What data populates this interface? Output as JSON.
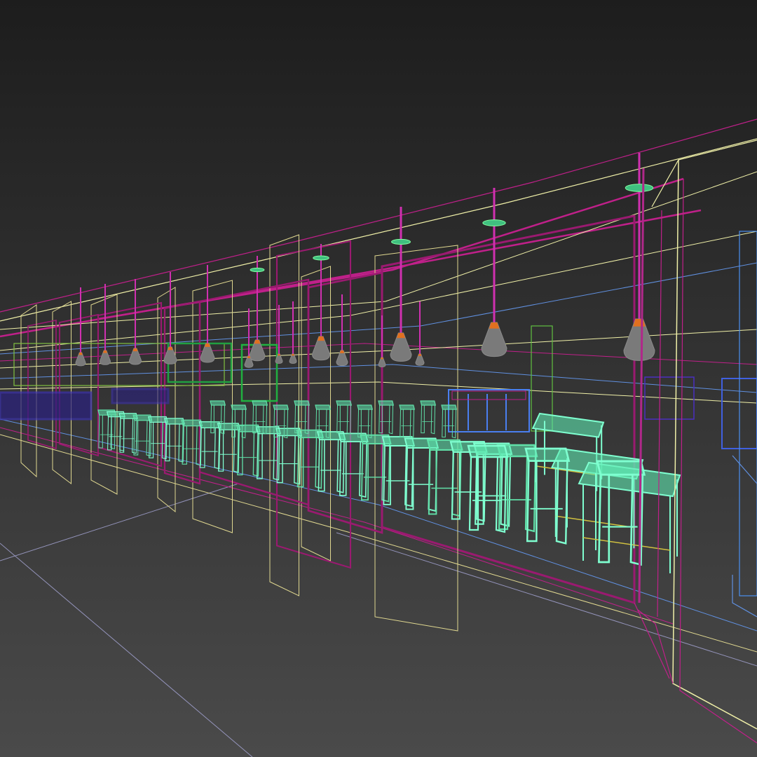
{
  "viewport": {
    "mode": "wireframe-perspective",
    "background_top": "#1d1d1d",
    "background_bottom": "#4a4a4a",
    "wire_colors": {
      "ceiling": "#f0f0a8",
      "beam": "#c0208a",
      "frame": "#9a1a70",
      "counter_edge": "#e0d890",
      "stool": "#7fffd0",
      "stool_alt": "#60e0a8",
      "table": "#5fe8b0",
      "cabinet": "#4a7ff0",
      "lamp_shade": "#7a7a7a",
      "lamp_top": "#e07020",
      "ceiling_disc": "#40c080",
      "ground": "#a8a8d8",
      "back_wall": "#80c040"
    }
  },
  "scene": {
    "pendant_lamps": 16,
    "bar_stools": 34,
    "high_tables": 3
  }
}
